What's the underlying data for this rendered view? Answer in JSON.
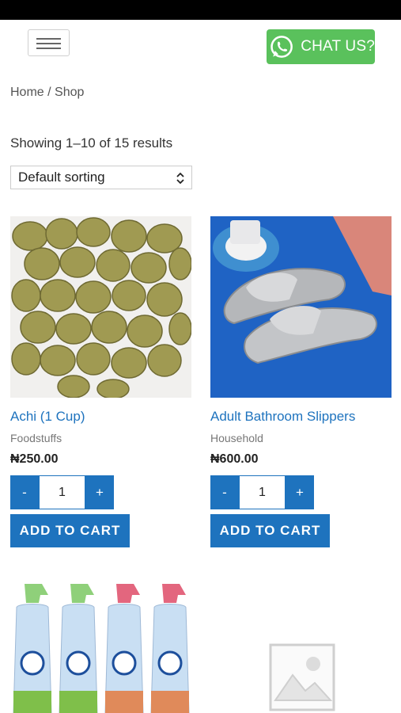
{
  "header": {
    "menu_icon": "hamburger-icon",
    "chat_label": "CHAT US?",
    "chat_icon": "whatsapp-icon",
    "chat_color": "#5ac15c"
  },
  "breadcrumb": "Home / Shop",
  "results_text": "Showing 1–10 of 15 results",
  "sorting": {
    "selected": "Default sorting"
  },
  "accent_color": "#1e73be",
  "products": [
    {
      "title": "Achi (1 Cup)",
      "category": "Foodstuffs",
      "price": "₦250.00",
      "qty": "1",
      "minus": "-",
      "plus": "+",
      "button": "ADD TO CART"
    },
    {
      "title": "Adult Bathroom Slippers",
      "category": "Household",
      "price": "₦600.00",
      "qty": "1",
      "minus": "-",
      "plus": "+",
      "button": "ADD TO CART"
    }
  ],
  "next_row": {
    "third_image": "febreze-bottles-image",
    "fourth_image": "placeholder-image-icon"
  }
}
